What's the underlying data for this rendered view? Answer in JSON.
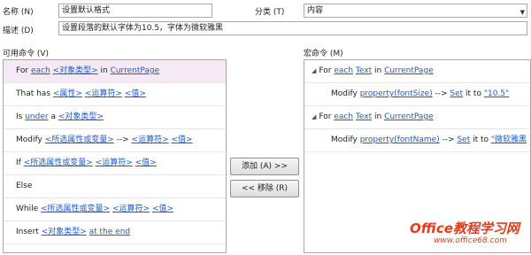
{
  "form": {
    "name_label": "名称 (N)",
    "name_value": "设置默认格式",
    "category_label": "分类 (T)",
    "category_value": "内容",
    "desc_label": "描述 (D)",
    "desc_value": "设置段落的默认字体为10.5，字体为微软雅黑"
  },
  "available": {
    "header": "可用命令 (V)",
    "rows": [
      {
        "parts": [
          [
            "p",
            "For "
          ],
          [
            "l",
            "each"
          ],
          [
            "p",
            " "
          ],
          [
            "l",
            "<对象类型>"
          ],
          [
            "p",
            " in "
          ],
          [
            "l",
            "CurrentPage"
          ]
        ]
      },
      {
        "parts": [
          [
            "p",
            "That has "
          ],
          [
            "l",
            "<属性>"
          ],
          [
            "p",
            " "
          ],
          [
            "l",
            "<运算符>"
          ],
          [
            "p",
            " "
          ],
          [
            "l",
            "<值>"
          ]
        ]
      },
      {
        "parts": [
          [
            "p",
            "Is "
          ],
          [
            "l",
            "under"
          ],
          [
            "p",
            " a "
          ],
          [
            "l",
            "<对象类型>"
          ]
        ]
      },
      {
        "parts": [
          [
            "p",
            "Modify "
          ],
          [
            "l",
            "<所选属性或变量>"
          ],
          [
            "p",
            " --> "
          ],
          [
            "l",
            "<运算符>"
          ],
          [
            "p",
            " "
          ],
          [
            "l",
            "<值>"
          ]
        ]
      },
      {
        "parts": [
          [
            "p",
            "If "
          ],
          [
            "l",
            "<所选属性或变量>"
          ],
          [
            "p",
            " "
          ],
          [
            "l",
            "<运算符>"
          ],
          [
            "p",
            " "
          ],
          [
            "l",
            "<值>"
          ]
        ]
      },
      {
        "parts": [
          [
            "p",
            "Else"
          ]
        ]
      },
      {
        "parts": [
          [
            "p",
            "While "
          ],
          [
            "l",
            "<所选属性或变量>"
          ],
          [
            "p",
            " "
          ],
          [
            "l",
            "<运算符>"
          ],
          [
            "p",
            " "
          ],
          [
            "l",
            "<值>"
          ]
        ]
      },
      {
        "parts": [
          [
            "p",
            "Insert "
          ],
          [
            "l",
            "<对象类型>"
          ],
          [
            "p",
            " "
          ],
          [
            "l",
            "at the end"
          ]
        ]
      }
    ]
  },
  "buttons": {
    "add": "添加 (A) >>",
    "remove": "<< 移除 (R)"
  },
  "macro": {
    "header": "宏命令 (M)",
    "rows": [
      {
        "parts": [
          [
            "p",
            "For "
          ],
          [
            "l",
            "each"
          ],
          [
            "p",
            " "
          ],
          [
            "l",
            "Text"
          ],
          [
            "p",
            " in "
          ],
          [
            "l",
            "CurrentPage"
          ]
        ]
      },
      {
        "parts": [
          [
            "p",
            "Modify "
          ],
          [
            "l",
            "property(fontSize)"
          ],
          [
            "p",
            " --> "
          ],
          [
            "l",
            "Set"
          ],
          [
            "p",
            " it to "
          ],
          [
            "l",
            "\"10.5\""
          ]
        ]
      },
      {
        "parts": [
          [
            "p",
            "For "
          ],
          [
            "l",
            "each"
          ],
          [
            "p",
            " "
          ],
          [
            "l",
            "Text"
          ],
          [
            "p",
            " in "
          ],
          [
            "l",
            "CurrentPage"
          ]
        ]
      },
      {
        "parts": [
          [
            "p",
            "Modify "
          ],
          [
            "l",
            "property(fontName)"
          ],
          [
            "p",
            " --> "
          ],
          [
            "l",
            "Set"
          ],
          [
            "p",
            " it to "
          ],
          [
            "l",
            "\"微软雅黑"
          ]
        ]
      }
    ]
  },
  "watermark": {
    "title_a": "Office",
    "title_b": "教程学习网",
    "url": "www.office68.com"
  },
  "colors": {
    "link": "#1d5cc8",
    "selected_row": "#f6e9f6",
    "watermark": "#e53a1b"
  },
  "icons": {
    "expander": "collapse-triangle-icon",
    "dropdown": "chevron-down-icon"
  }
}
